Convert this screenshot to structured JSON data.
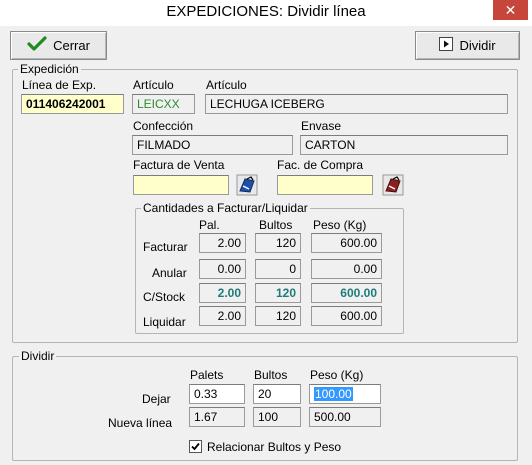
{
  "window": {
    "title": "EXPEDICIONES: Dividir línea",
    "close_label": "✕"
  },
  "toolbar": {
    "close_label": "Cerrar",
    "split_label": "Dividir"
  },
  "expedicion": {
    "group_label": "Expedición",
    "linea_label": "Línea de Exp.",
    "linea_value": "011406242001",
    "articulo_code_label": "Artículo",
    "articulo_code_value": "LEICXX",
    "articulo_name_label": "Artículo",
    "articulo_name_value": "LECHUGA ICEBERG",
    "confeccion_label": "Confección",
    "confeccion_value": "FILMADO",
    "envase_label": "Envase",
    "envase_value": "CARTON",
    "factura_venta_label": "Factura de Venta",
    "factura_venta_value": "",
    "fac_compra_label": "Fac. de Compra",
    "fac_compra_value": ""
  },
  "cantidades": {
    "group_label": "Cantidades a Facturar/Liquidar",
    "headers": [
      "Pal.",
      "Bultos",
      "Peso (Kg)"
    ],
    "rows": [
      {
        "label": "Facturar",
        "pal": "2.00",
        "bultos": "120",
        "peso": "600.00"
      },
      {
        "label": "Anular",
        "pal": "0.00",
        "bultos": "0",
        "peso": "0.00"
      },
      {
        "label": "C/Stock",
        "pal": "2.00",
        "bultos": "120",
        "peso": "600.00"
      },
      {
        "label": "Liquidar",
        "pal": "2.00",
        "bultos": "120",
        "peso": "600.00"
      }
    ]
  },
  "dividir": {
    "group_label": "Dividir",
    "headers": [
      "Palets",
      "Bultos",
      "Peso (Kg)"
    ],
    "dejar_label": "Dejar",
    "dejar": {
      "palets": "0.33",
      "bultos": "20",
      "peso": "100.00"
    },
    "nueva_label": "Nueva línea",
    "nueva": {
      "palets": "1.67",
      "bultos": "100",
      "peso": "500.00"
    },
    "relacionar_label": "Relacionar Bultos y Peso",
    "relacionar_checked": true
  }
}
